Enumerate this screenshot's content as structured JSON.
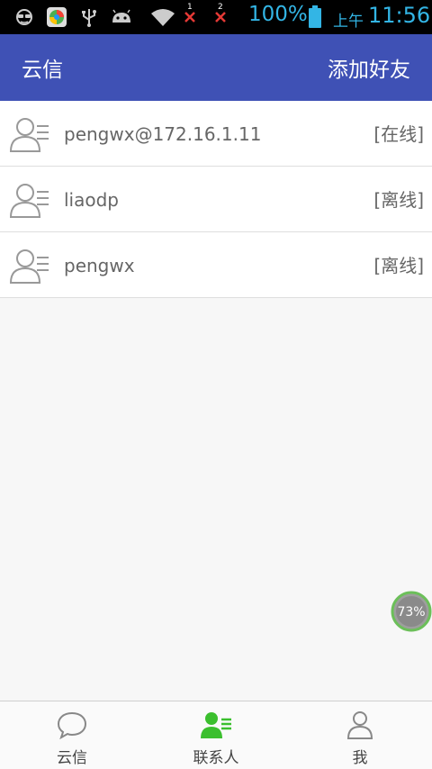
{
  "status_bar": {
    "battery_percent": "100%",
    "am_pm": "上午",
    "time": "11:56",
    "sim1": "1",
    "sim2": "2",
    "icons": [
      "incognito-icon",
      "browser-app-icon",
      "usb-icon",
      "android-debug-icon",
      "wifi-icon",
      "no-signal-icon",
      "no-signal-icon",
      "battery-icon"
    ]
  },
  "app_bar": {
    "title": "云信",
    "action_label": "添加好友"
  },
  "contacts": [
    {
      "name": "pengwx@172.16.1.11",
      "status": "[在线]"
    },
    {
      "name": "liaodp",
      "status": "[离线]"
    },
    {
      "name": "pengwx",
      "status": "[离线]"
    }
  ],
  "floating_badge": {
    "label": "73%",
    "value": 0.73
  },
  "bottom_nav": {
    "tabs": [
      {
        "label": "云信",
        "icon": "chat-bubble-icon",
        "active": false
      },
      {
        "label": "联系人",
        "icon": "contacts-icon",
        "active": true
      },
      {
        "label": "我",
        "icon": "person-icon",
        "active": false
      }
    ],
    "active_color": "#3bbf2e"
  },
  "colors": {
    "app_bar": "#3f51b5",
    "status_text": "#33b5e5"
  }
}
